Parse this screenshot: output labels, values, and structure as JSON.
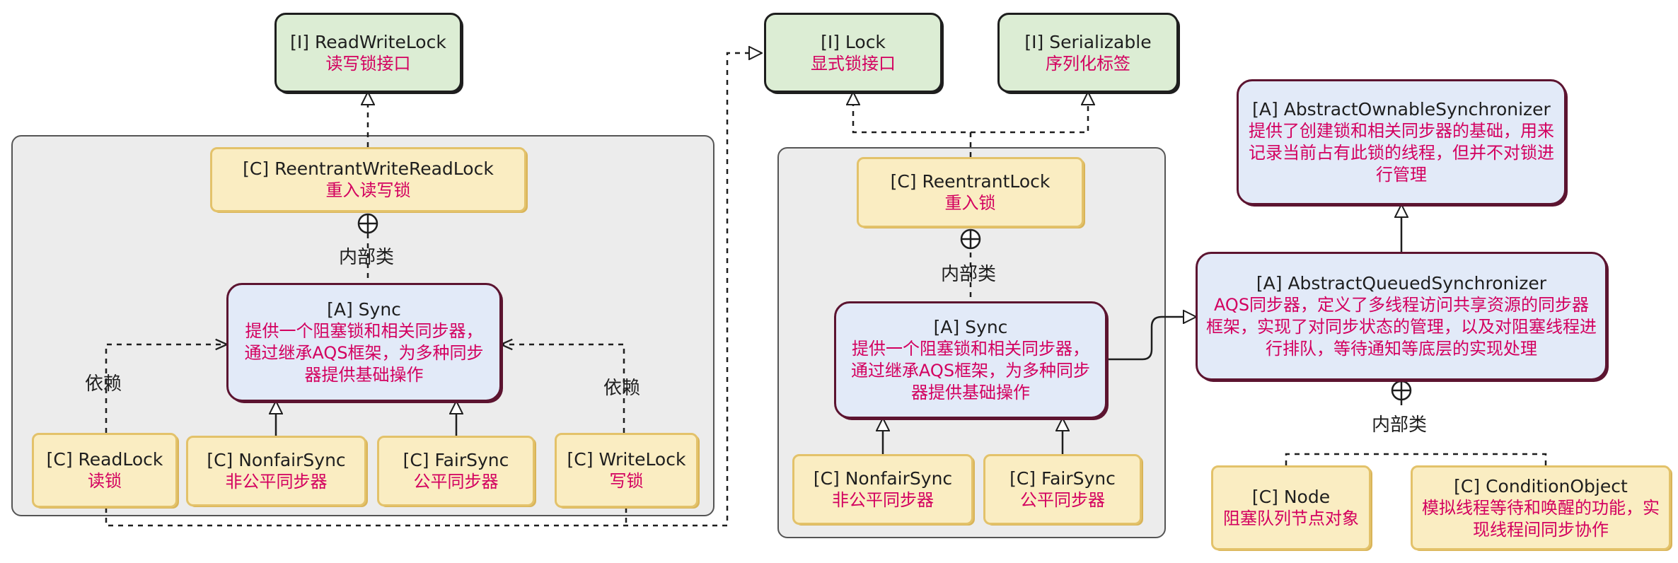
{
  "nodes": {
    "readwritelock": {
      "title": "[I] ReadWriteLock",
      "desc": "读写锁接口"
    },
    "reentrant_write_read_lock": {
      "title": "[C] ReentrantWriteReadLock",
      "desc": "重入读写锁"
    },
    "sync_left": {
      "title": "[A] Sync",
      "desc": "提供一个阻塞锁和相关同步器，通过继承AQS框架，为多种同步器提供基础操作"
    },
    "readlock": {
      "title": "[C] ReadLock",
      "desc": "读锁"
    },
    "nonfairsync_left": {
      "title": "[C] NonfairSync",
      "desc": "非公平同步器"
    },
    "fairsync_left": {
      "title": "[C] FairSync",
      "desc": "公平同步器"
    },
    "writelock": {
      "title": "[C] WriteLock",
      "desc": "写锁"
    },
    "lock": {
      "title": "[I] Lock",
      "desc": "显式锁接口"
    },
    "serializable": {
      "title": "[I] Serializable",
      "desc": "序列化标签"
    },
    "reentrantlock": {
      "title": "[C] ReentrantLock",
      "desc": "重入锁"
    },
    "sync_mid": {
      "title": "[A] Sync",
      "desc": "提供一个阻塞锁和相关同步器，通过继承AQS框架，为多种同步器提供基础操作"
    },
    "nonfairsync_mid": {
      "title": "[C] NonfairSync",
      "desc": "非公平同步器"
    },
    "fairsync_mid": {
      "title": "[C] FairSync",
      "desc": "公平同步器"
    },
    "aos": {
      "title": "[A] AbstractOwnableSynchronizer",
      "desc": "提供了创建锁和相关同步器的基础，用来记录当前占有此锁的线程，但并不对锁进行管理"
    },
    "aqs": {
      "title": "[A] AbstractQueuedSynchronizer",
      "desc": "AQS同步器，定义了多线程访问共享资源的同步器框架，实现了对同步状态的管理，以及对阻塞线程进行排队，等待通知等底层的实现处理"
    },
    "node": {
      "title": "[C] Node",
      "desc": "阻塞队列节点对象"
    },
    "conditionobject": {
      "title": "[C] ConditionObject",
      "desc": "模拟线程等待和唤醒的功能，实现线程间同步协作"
    }
  },
  "labels": {
    "inner_class": "内部类",
    "depends": "依赖"
  }
}
